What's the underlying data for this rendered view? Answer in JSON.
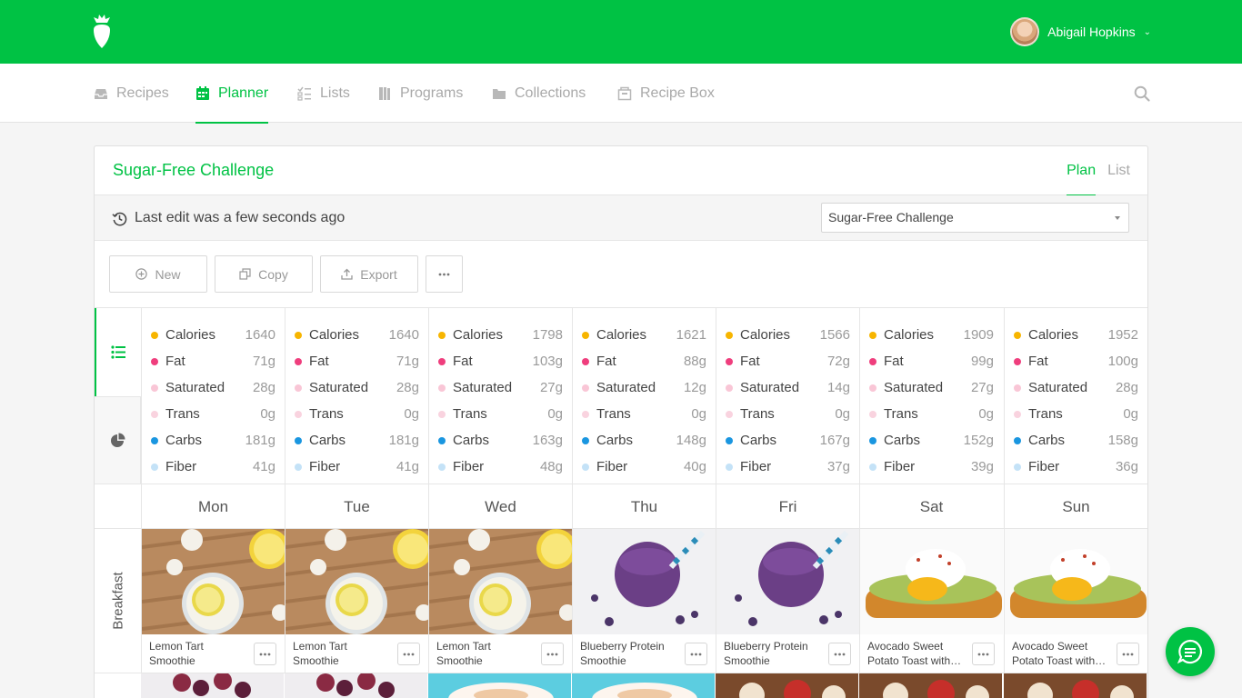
{
  "app": {
    "brand_color": "#00c244",
    "user": {
      "name": "Abigail Hopkins"
    }
  },
  "nav": {
    "items": [
      {
        "label": "Recipes",
        "icon": "tray-icon"
      },
      {
        "label": "Planner",
        "icon": "calendar-icon",
        "active": true
      },
      {
        "label": "Lists",
        "icon": "checklist-icon"
      },
      {
        "label": "Programs",
        "icon": "books-icon"
      },
      {
        "label": "Collections",
        "icon": "folder-icon"
      },
      {
        "label": "Recipe Box",
        "icon": "box-icon"
      }
    ]
  },
  "plan": {
    "title": "Sugar-Free Challenge",
    "tabs": {
      "plan": "Plan",
      "list": "List"
    },
    "last_edit": "Last edit was a few seconds ago",
    "selected_plan": "Sugar-Free Challenge"
  },
  "toolbar": {
    "new_label": "New",
    "copy_label": "Copy",
    "export_label": "Export"
  },
  "nutrient_colors": {
    "Calories": "#f7b500",
    "Fat": "#ef3e7d",
    "Saturated": "#f9c6d6",
    "Trans": "#f9d3df",
    "Carbs": "#1a96e0",
    "Fiber": "#c4e2f7"
  },
  "nutrition": [
    {
      "day": "Mon",
      "rows": [
        [
          "Calories",
          "1640"
        ],
        [
          "Fat",
          "71g"
        ],
        [
          "Saturated",
          "28g"
        ],
        [
          "Trans",
          "0g"
        ],
        [
          "Carbs",
          "181g"
        ],
        [
          "Fiber",
          "41g"
        ]
      ]
    },
    {
      "day": "Tue",
      "rows": [
        [
          "Calories",
          "1640"
        ],
        [
          "Fat",
          "71g"
        ],
        [
          "Saturated",
          "28g"
        ],
        [
          "Trans",
          "0g"
        ],
        [
          "Carbs",
          "181g"
        ],
        [
          "Fiber",
          "41g"
        ]
      ]
    },
    {
      "day": "Wed",
      "rows": [
        [
          "Calories",
          "1798"
        ],
        [
          "Fat",
          "103g"
        ],
        [
          "Saturated",
          "27g"
        ],
        [
          "Trans",
          "0g"
        ],
        [
          "Carbs",
          "163g"
        ],
        [
          "Fiber",
          "48g"
        ]
      ]
    },
    {
      "day": "Thu",
      "rows": [
        [
          "Calories",
          "1621"
        ],
        [
          "Fat",
          "88g"
        ],
        [
          "Saturated",
          "12g"
        ],
        [
          "Trans",
          "0g"
        ],
        [
          "Carbs",
          "148g"
        ],
        [
          "Fiber",
          "40g"
        ]
      ]
    },
    {
      "day": "Fri",
      "rows": [
        [
          "Calories",
          "1566"
        ],
        [
          "Fat",
          "72g"
        ],
        [
          "Saturated",
          "14g"
        ],
        [
          "Trans",
          "0g"
        ],
        [
          "Carbs",
          "167g"
        ],
        [
          "Fiber",
          "37g"
        ]
      ]
    },
    {
      "day": "Sat",
      "rows": [
        [
          "Calories",
          "1909"
        ],
        [
          "Fat",
          "99g"
        ],
        [
          "Saturated",
          "27g"
        ],
        [
          "Trans",
          "0g"
        ],
        [
          "Carbs",
          "152g"
        ],
        [
          "Fiber",
          "39g"
        ]
      ]
    },
    {
      "day": "Sun",
      "rows": [
        [
          "Calories",
          "1952"
        ],
        [
          "Fat",
          "100g"
        ],
        [
          "Saturated",
          "28g"
        ],
        [
          "Trans",
          "0g"
        ],
        [
          "Carbs",
          "158g"
        ],
        [
          "Fiber",
          "36g"
        ]
      ]
    }
  ],
  "days": [
    "Mon",
    "Tue",
    "Wed",
    "Thu",
    "Fri",
    "Sat",
    "Sun"
  ],
  "meals": [
    {
      "label": "Breakfast",
      "recipes": [
        {
          "name": "Lemon Tart Smoothie",
          "kind": "lemon"
        },
        {
          "name": "Lemon Tart Smoothie",
          "kind": "lemon"
        },
        {
          "name": "Lemon Tart Smoothie",
          "kind": "lemon"
        },
        {
          "name": "Blueberry Protein Smoothie",
          "kind": "blueberry"
        },
        {
          "name": "Blueberry Protein Smoothie",
          "kind": "blueberry"
        },
        {
          "name": "Avocado Sweet Potato Toast with…",
          "kind": "toast"
        },
        {
          "name": "Avocado Sweet Potato Toast with…",
          "kind": "toast"
        }
      ]
    }
  ],
  "next_row_kinds": [
    "berries",
    "berries",
    "pancake",
    "pancake",
    "apples",
    "apples",
    "apples"
  ]
}
